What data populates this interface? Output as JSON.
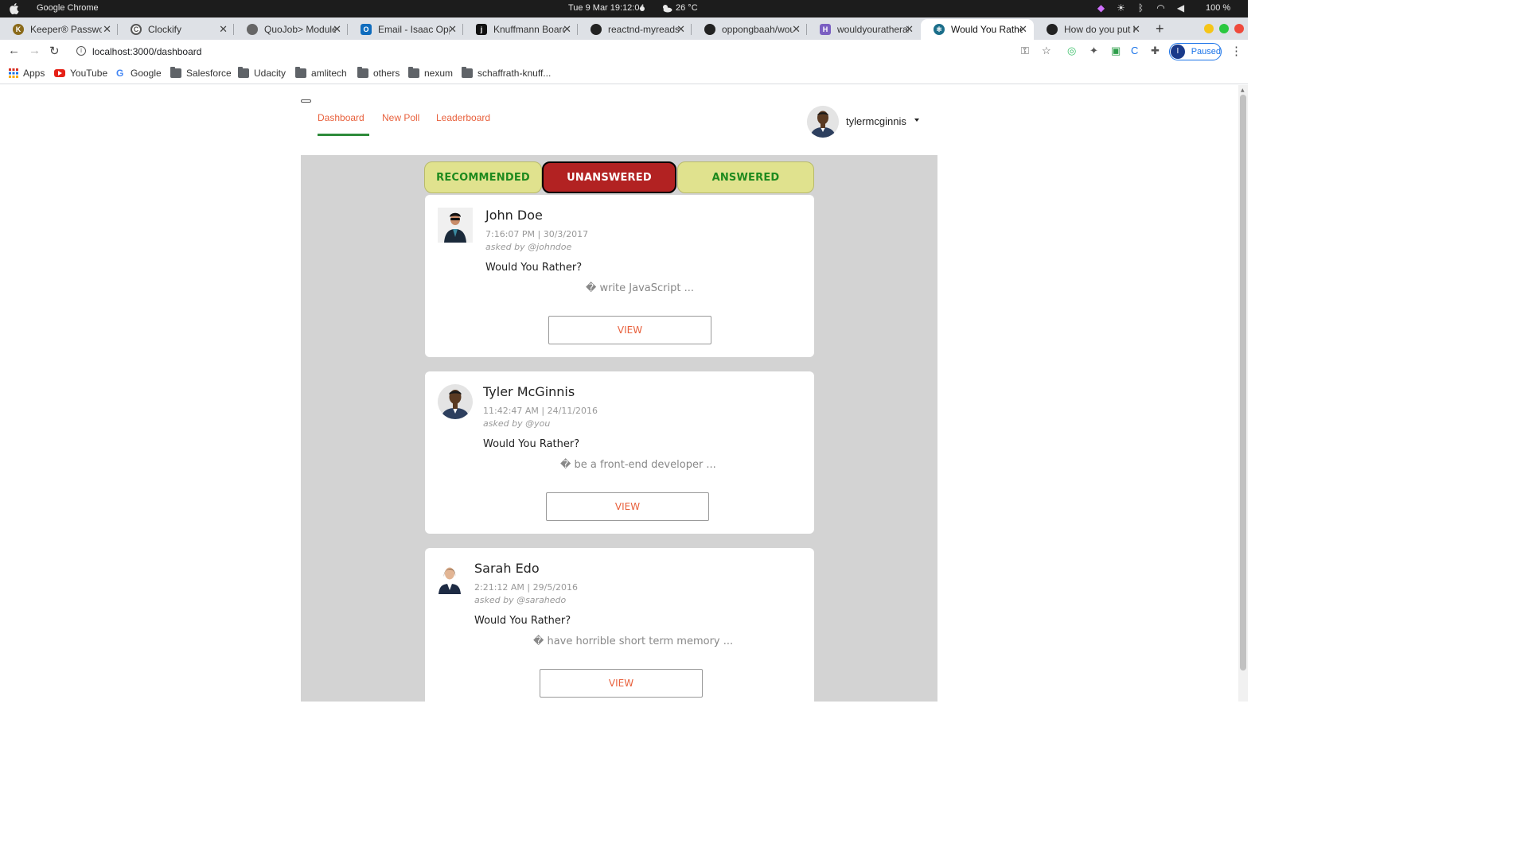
{
  "os": {
    "app_name": "Google Chrome",
    "clock": "Tue 9 Mar   19:12:04",
    "temperature": "26 °C",
    "battery": "100 %"
  },
  "tabs": [
    {
      "title": "Keeper® Password",
      "icon": "keeper-icon",
      "color": "#8a6a1a"
    },
    {
      "title": "Clockify",
      "icon": "clockify-icon",
      "color": "#555555"
    },
    {
      "title": "QuoJob> Module I",
      "icon": "globe-icon",
      "color": "#666666"
    },
    {
      "title": "Email - Isaac Opp",
      "icon": "outlook-icon",
      "color": "#0f6cbd"
    },
    {
      "title": "Knuffmann Board",
      "icon": "jira-icon",
      "color": "#111111"
    },
    {
      "title": "reactnd-myreads",
      "icon": "github-icon",
      "color": "#222222"
    },
    {
      "title": "oppongbaah/wou",
      "icon": "github-icon",
      "color": "#222222"
    },
    {
      "title": "wouldyouratheral",
      "icon": "heroku-icon",
      "color": "#7b5fc2"
    },
    {
      "title": "Would You Rather",
      "icon": "react-icon",
      "color": "#1b6e8a"
    },
    {
      "title": "How do you put li",
      "icon": "github-icon",
      "color": "#222222"
    }
  ],
  "address": {
    "url": "localhost:3000/dashboard",
    "profile_initial": "I",
    "profile_status": "Paused"
  },
  "bookmarks": [
    {
      "label": "Apps",
      "icon": "apps-grid-icon"
    },
    {
      "label": "YouTube",
      "icon": "youtube-icon"
    },
    {
      "label": "Google",
      "icon": "google-icon"
    },
    {
      "label": "Salesforce",
      "icon": "folder-icon"
    },
    {
      "label": "Udacity",
      "icon": "folder-icon"
    },
    {
      "label": "amlitech",
      "icon": "folder-icon"
    },
    {
      "label": "others",
      "icon": "folder-icon"
    },
    {
      "label": "nexum",
      "icon": "folder-icon"
    },
    {
      "label": "schaffrath-knuff...",
      "icon": "folder-icon"
    }
  ],
  "app": {
    "nav": {
      "dashboard": "Dashboard",
      "new_poll": "New Poll",
      "leaderboard": "Leaderboard"
    },
    "user": {
      "username": "tylermcginnis"
    },
    "filters": {
      "recommended": "RECOMMENDED",
      "unanswered": "UNANSWERED",
      "answered": "ANSWERED",
      "active": "unanswered"
    },
    "polls": [
      {
        "name": "John Doe",
        "time": "7:16:07 PM | 30/3/2017",
        "asked_by": "asked by @johndoe",
        "question": "Would You Rather?",
        "option": "� write JavaScript ...",
        "view_label": "VIEW"
      },
      {
        "name": "Tyler McGinnis",
        "time": "11:42:47 AM | 24/11/2016",
        "asked_by": "asked by @you",
        "question": "Would You Rather?",
        "option": "� be a front-end developer ...",
        "view_label": "VIEW"
      },
      {
        "name": "Sarah Edo",
        "time": "2:21:12 AM | 29/5/2016",
        "asked_by": "asked by @sarahedo",
        "question": "Would You Rather?",
        "option": "� have horrible short term memory ...",
        "view_label": "VIEW"
      }
    ]
  },
  "colors": {
    "accent": "#e8603c",
    "active_underline": "#2e8b3a",
    "filter_active": "#b22222",
    "filter_inactive": "#e0e28e",
    "filter_text": "#1e8a1e",
    "panel": "#d3d3d3"
  }
}
